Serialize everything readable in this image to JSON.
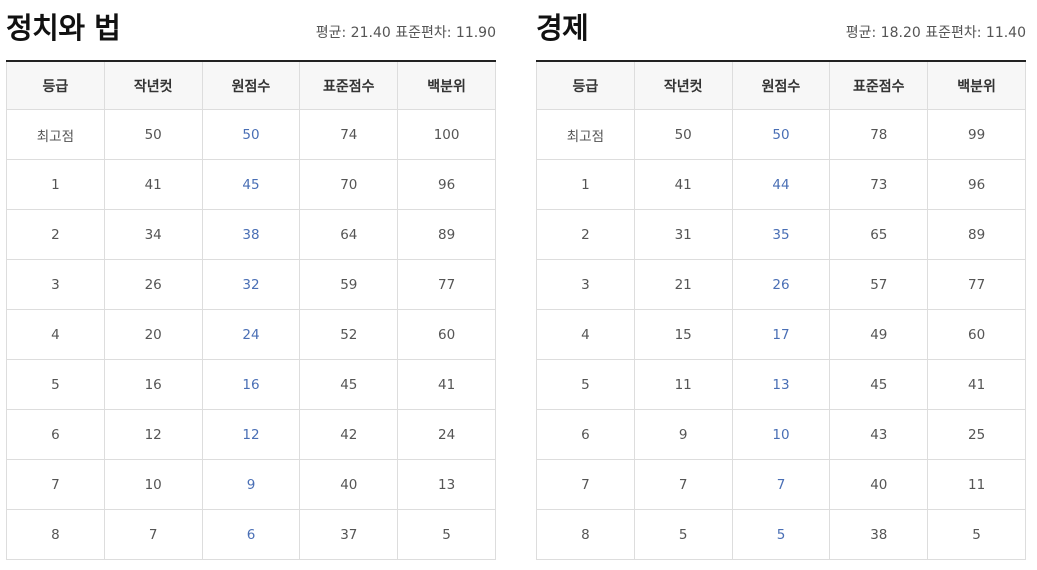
{
  "columns": [
    "등급",
    "작년컷",
    "원점수",
    "표준점수",
    "백분위"
  ],
  "panels": [
    {
      "title": "정치와 법",
      "mean_text": "평균: 21.40",
      "sd_text": "표준편차: 11.90",
      "rows": [
        [
          "최고점",
          "50",
          "50",
          "74",
          "100"
        ],
        [
          "1",
          "41",
          "45",
          "70",
          "96"
        ],
        [
          "2",
          "34",
          "38",
          "64",
          "89"
        ],
        [
          "3",
          "26",
          "32",
          "59",
          "77"
        ],
        [
          "4",
          "20",
          "24",
          "52",
          "60"
        ],
        [
          "5",
          "16",
          "16",
          "45",
          "41"
        ],
        [
          "6",
          "12",
          "12",
          "42",
          "24"
        ],
        [
          "7",
          "10",
          "9",
          "40",
          "13"
        ],
        [
          "8",
          "7",
          "6",
          "37",
          "5"
        ]
      ]
    },
    {
      "title": "경제",
      "mean_text": "평균: 18.20",
      "sd_text": "표준편차: 11.40",
      "rows": [
        [
          "최고점",
          "50",
          "50",
          "78",
          "99"
        ],
        [
          "1",
          "41",
          "44",
          "73",
          "96"
        ],
        [
          "2",
          "31",
          "35",
          "65",
          "89"
        ],
        [
          "3",
          "21",
          "26",
          "57",
          "77"
        ],
        [
          "4",
          "15",
          "17",
          "49",
          "60"
        ],
        [
          "5",
          "11",
          "13",
          "45",
          "41"
        ],
        [
          "6",
          "9",
          "10",
          "43",
          "25"
        ],
        [
          "7",
          "7",
          "7",
          "40",
          "11"
        ],
        [
          "8",
          "5",
          "5",
          "38",
          "5"
        ]
      ]
    }
  ],
  "colors": {
    "raw_score_text": "#4a6fb5",
    "body_text": "#555555",
    "header_bg": "#f7f7f7",
    "border": "#dddddd",
    "top_rule": "#222222"
  }
}
